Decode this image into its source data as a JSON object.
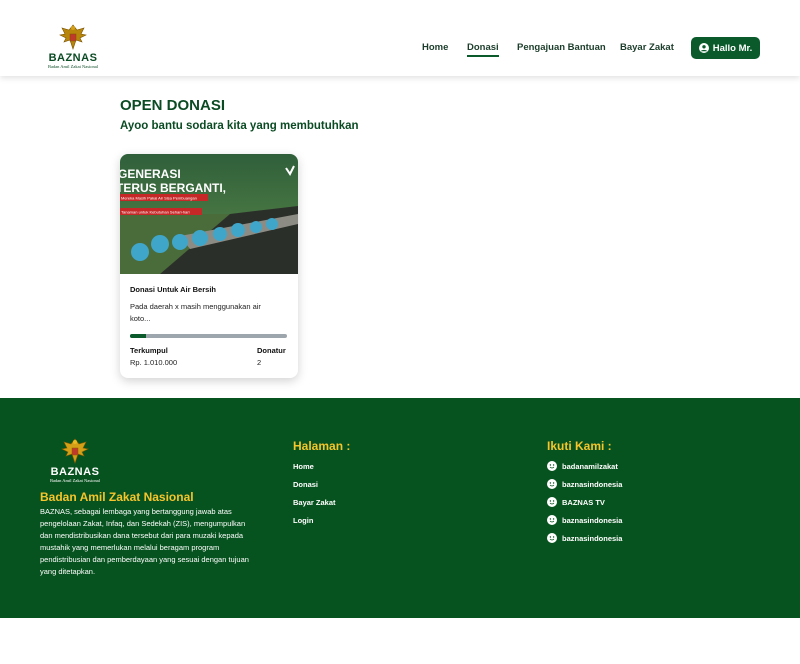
{
  "header": {
    "logo": {
      "title": "BAZNAS",
      "subtitle": "Badan Amil Zakat Nasional"
    },
    "nav": [
      {
        "label": "Home"
      },
      {
        "label": "Donasi"
      },
      {
        "label": "Pengajuan Bantuan"
      },
      {
        "label": "Bayar Zakat"
      }
    ],
    "active_nav": "Donasi",
    "user_button": {
      "label": "Hallo Mr.",
      "icon": "user-circle-icon"
    }
  },
  "main": {
    "title": "OPEN DONASI",
    "subtitle": "Ayoo bantu sodara kita yang membutuhkan",
    "cards": [
      {
        "image": {
          "headline_line1": "GENERASI",
          "headline_line2": "TERUS BERGANTI,",
          "caption_line1": "Mereka Masih Pakai Air Sisa Pembuangan",
          "caption_line2": "Tanaman untuk Kebutuhan Sehari-hari"
        },
        "title": "Donasi Untuk Air Bersih",
        "description": "Pada daerah x masih menggunakan air koto...",
        "progress_fraction": 0.1,
        "collected_label": "Terkumpul",
        "collected_value": "Rp. 1.010.000",
        "donors_label": "Donatur",
        "donors_value": "2"
      }
    ]
  },
  "footer": {
    "logo": {
      "title": "BAZNAS",
      "subtitle": "Badan Amil Zakat Nasional"
    },
    "org_name": "Badan Amil Zakat Nasional",
    "description": "BAZNAS, sebagai lembaga yang bertanggung jawab atas pengelolaan Zakat, Infaq, dan Sedekah (ZIS), mengumpulkan dan mendistribusikan dana tersebut dari para muzaki kepada mustahik yang memerlukan melalui beragam program pendistribusian dan pemberdayaan yang sesuai dengan tujuan yang ditetapkan.",
    "pages_heading": "Halaman :",
    "pages": [
      {
        "label": "Home"
      },
      {
        "label": "Donasi"
      },
      {
        "label": "Bayar Zakat"
      },
      {
        "label": "Login"
      }
    ],
    "follow_heading": "Ikuti Kami :",
    "socials": [
      {
        "label": "badanamilzakat",
        "icon": "smile-icon"
      },
      {
        "label": "baznasindonesia",
        "icon": "smile-icon"
      },
      {
        "label": "BAZNAS TV",
        "icon": "smile-icon"
      },
      {
        "label": "baznasindonesia",
        "icon": "smile-icon"
      },
      {
        "label": "baznasindonesia",
        "icon": "smile-icon"
      }
    ]
  },
  "colors": {
    "brand_green": "#0b5a2b",
    "footer_green": "#07531f",
    "accent_yellow": "#f6c42b"
  }
}
